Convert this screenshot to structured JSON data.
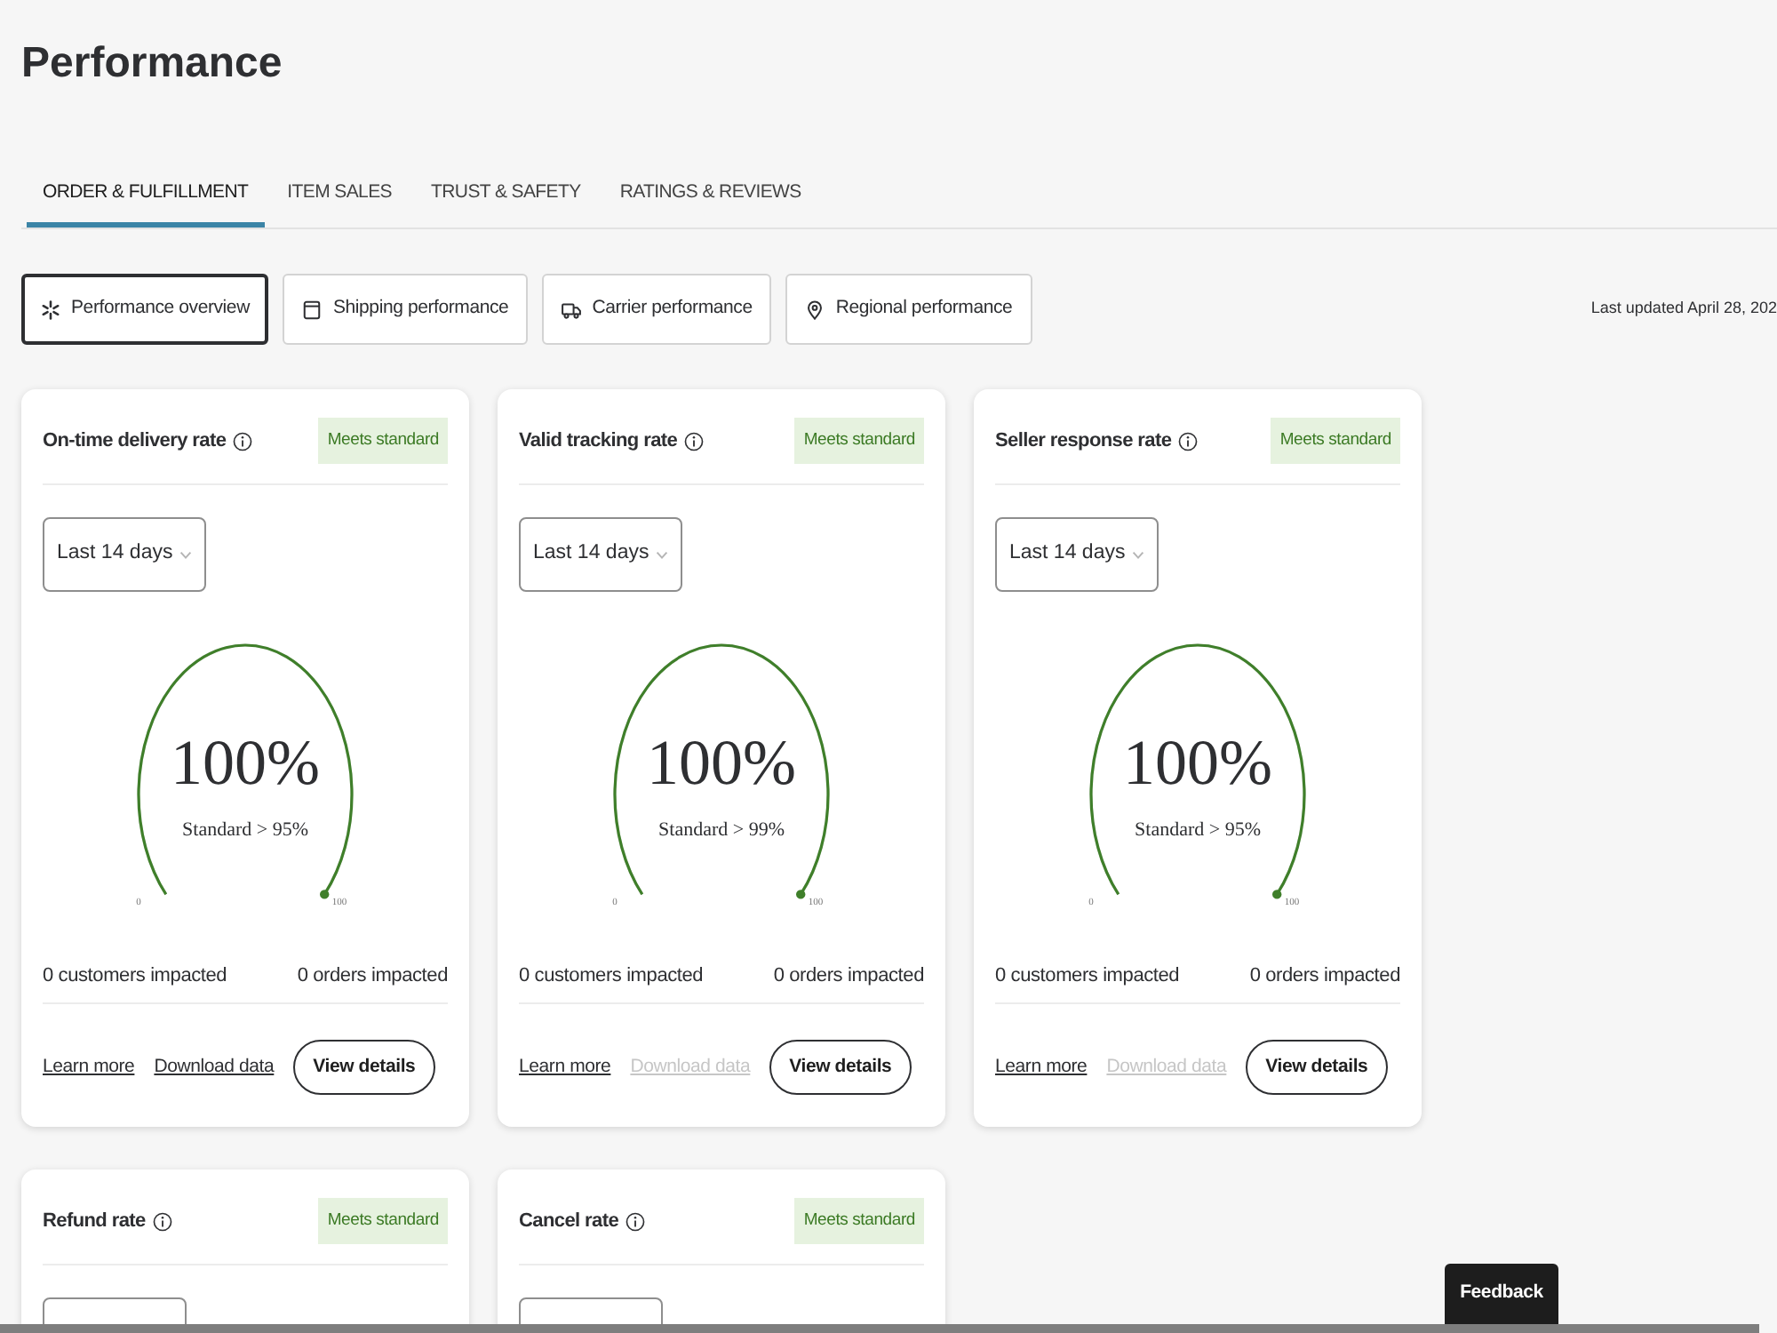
{
  "page": {
    "title": "Performance"
  },
  "tabs": [
    {
      "label": "ORDER & FULFILLMENT",
      "selected": true
    },
    {
      "label": "ITEM SALES",
      "selected": false
    },
    {
      "label": "TRUST & SAFETY",
      "selected": false
    },
    {
      "label": "RATINGS & REVIEWS",
      "selected": false
    }
  ],
  "views": [
    {
      "label": "Performance overview",
      "selected": true
    },
    {
      "label": "Shipping performance",
      "selected": false
    },
    {
      "label": "Carrier performance",
      "selected": false
    },
    {
      "label": "Regional performance",
      "selected": false
    }
  ],
  "last_updated": "Last updated April 28, 202",
  "metrics": [
    {
      "title": "On-time delivery rate",
      "status": "Meets standard",
      "period": "Last 14 days",
      "gauge": {
        "value": "100%",
        "standard": "Standard > 95%",
        "min_label": "0",
        "max_label": "100",
        "level": 1
      },
      "customers_impacted": "0 customers impacted",
      "orders_impacted": "0 orders impacted",
      "learn_more": "Learn more",
      "download": {
        "label": "Download data",
        "disabled": false
      },
      "view_details": "View details"
    },
    {
      "title": "Valid tracking rate",
      "status": "Meets standard",
      "period": "Last 14 days",
      "gauge": {
        "value": "100%",
        "standard": "Standard > 99%",
        "min_label": "0",
        "max_label": "100",
        "level": 1
      },
      "customers_impacted": "0 customers impacted",
      "orders_impacted": "0 orders impacted",
      "learn_more": "Learn more",
      "download": {
        "label": "Download data",
        "disabled": true
      },
      "view_details": "View details"
    },
    {
      "title": "Seller response rate",
      "status": "Meets standard",
      "period": "Last 14 days",
      "gauge": {
        "value": "100%",
        "standard": "Standard > 95%",
        "min_label": "0",
        "max_label": "100",
        "level": 1
      },
      "customers_impacted": "0 customers impacted",
      "orders_impacted": "0 orders impacted",
      "learn_more": "Learn more",
      "download": {
        "label": "Download data",
        "disabled": true
      },
      "view_details": "View details"
    },
    {
      "title": "Refund rate",
      "status": "Meets standard"
    },
    {
      "title": "Cancel rate",
      "status": "Meets standard"
    }
  ],
  "feedback": "Feedback"
}
